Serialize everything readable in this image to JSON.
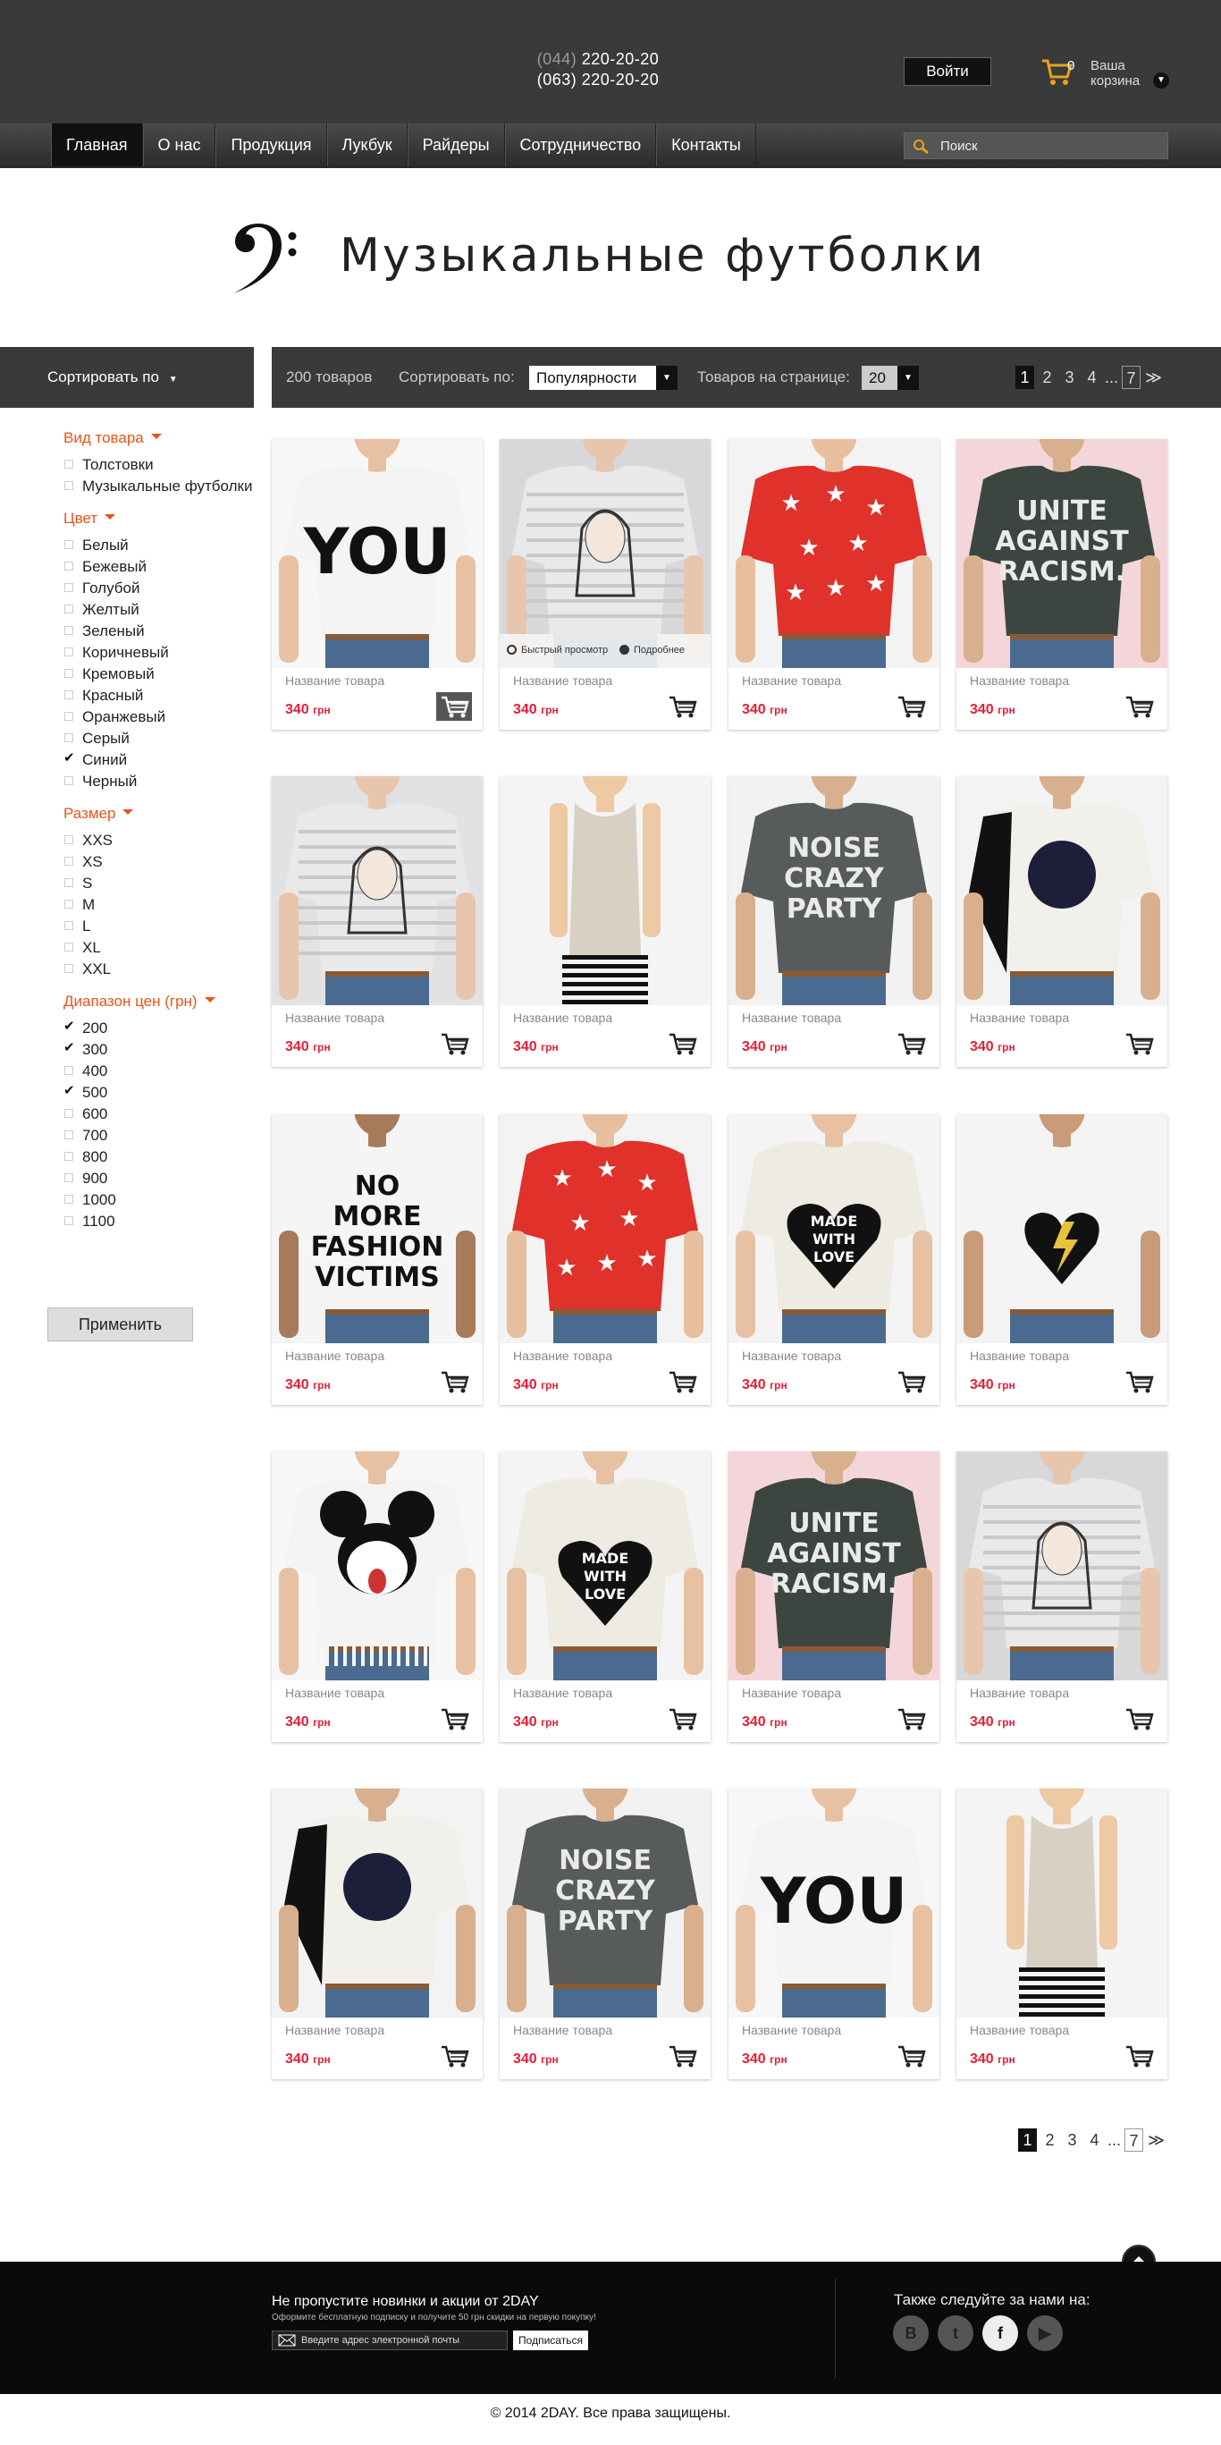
{
  "header": {
    "phone1_code": "(044)",
    "phone1_number": "220-20-20",
    "phone2": "(063) 220-20-20",
    "login_label": "Войти",
    "cart_count": "0",
    "cart_line1": "Ваша",
    "cart_line2": "корзина"
  },
  "nav": [
    "Главная",
    "О нас",
    "Продукция",
    "Лукбук",
    "Райдеры",
    "Сотрудничество",
    "Контакты"
  ],
  "search": {
    "placeholder": "Поиск"
  },
  "page_title": "Музыкальные футболки",
  "sort_side_label": "Сортировать по",
  "toolbar": {
    "count": "200 товаров",
    "sort_label": "Сортировать по:",
    "sort_value": "Популярности",
    "per_page_label": "Товаров на странице:",
    "per_page_value": "20"
  },
  "pager": {
    "pages": [
      "1",
      "2",
      "3",
      "4"
    ],
    "ellipsis": "...",
    "last": "7",
    "next": "≫"
  },
  "filters": [
    {
      "title": "Вид товара",
      "options": [
        {
          "label": "Толстовки",
          "checked": false
        },
        {
          "label": "Музыкальные футболки",
          "checked": false
        }
      ]
    },
    {
      "title": "Цвет",
      "options": [
        {
          "label": "Белый",
          "checked": false
        },
        {
          "label": "Бежевый",
          "checked": false
        },
        {
          "label": "Голубой",
          "checked": false
        },
        {
          "label": "Желтый",
          "checked": false
        },
        {
          "label": "Зеленый",
          "checked": false
        },
        {
          "label": "Коричневый",
          "checked": false
        },
        {
          "label": "Кремовый",
          "checked": false
        },
        {
          "label": "Красный",
          "checked": false
        },
        {
          "label": "Оранжевый",
          "checked": false
        },
        {
          "label": "Серый",
          "checked": false
        },
        {
          "label": "Синий",
          "checked": true
        },
        {
          "label": "Черный",
          "checked": false
        }
      ]
    },
    {
      "title": "Размер",
      "options": [
        {
          "label": "XXS",
          "checked": false
        },
        {
          "label": "XS",
          "checked": false
        },
        {
          "label": "S",
          "checked": false
        },
        {
          "label": "M",
          "checked": false
        },
        {
          "label": "L",
          "checked": false
        },
        {
          "label": "XL",
          "checked": false
        },
        {
          "label": "XXL",
          "checked": false
        }
      ]
    },
    {
      "title": "Диапазон цен (грн)",
      "options": [
        {
          "label": "200",
          "checked": true
        },
        {
          "label": "300",
          "checked": true
        },
        {
          "label": "400",
          "checked": false
        },
        {
          "label": "500",
          "checked": true
        },
        {
          "label": "600",
          "checked": false
        },
        {
          "label": "700",
          "checked": false
        },
        {
          "label": "800",
          "checked": false
        },
        {
          "label": "900",
          "checked": false
        },
        {
          "label": "1000",
          "checked": false
        },
        {
          "label": "1100",
          "checked": false
        }
      ]
    }
  ],
  "apply_label": "Применить",
  "product": {
    "name": "Название товара",
    "price": "340",
    "currency": "грн"
  },
  "quick_view_label": "Быстрый просмотр",
  "details_label": "Подробнее",
  "products": [
    {
      "design": "you",
      "shirt": "#f4f4f4",
      "skin": "#e7c1a2",
      "bg": "#f7f7f7",
      "print": "YOU"
    },
    {
      "design": "girl",
      "shirt": "#e9e9ea",
      "skin": "#e8c6ad",
      "bg": "#d8d8da",
      "print": ""
    },
    {
      "design": "stars",
      "shirt": "#e0312b",
      "skin": "#e7bf9f",
      "bg": "#f3f3f3",
      "print": ""
    },
    {
      "design": "text",
      "shirt": "#3d4540",
      "skin": "#d8b08e",
      "bg": "#f4d6da",
      "print": "UNITE AGAINST RACISM."
    },
    {
      "design": "girl",
      "shirt": "#e9e9ea",
      "skin": "#e8c6ad",
      "bg": "#e2e2e4",
      "print": ""
    },
    {
      "design": "tank",
      "shirt": "#d8d0c2",
      "skin": "#edc9a4",
      "bg": "#f4f4f4",
      "print": ""
    },
    {
      "design": "text",
      "shirt": "#575b5c",
      "skin": "#d8b08e",
      "bg": "#f2f2f2",
      "print": "NOISE CRAZY PARTY"
    },
    {
      "design": "sleeve",
      "shirt": "#f2f0ea",
      "skin": "#d8b08e",
      "bg": "#f3f3f3",
      "print": ""
    },
    {
      "design": "text",
      "shirt": "#f5f5f5",
      "skin": "#a77a5a",
      "bg": "#f5f5f5",
      "print": "NO MORE FASHION VICTIMS"
    },
    {
      "design": "stars",
      "shirt": "#e0312b",
      "skin": "#e7bf9f",
      "bg": "#f3f3f3",
      "print": ""
    },
    {
      "design": "heart",
      "shirt": "#eeebe2",
      "skin": "#e7c1a2",
      "bg": "#f4f4f4",
      "print": "MADE WITH LOVE"
    },
    {
      "design": "bolt",
      "shirt": "#f4f4f4",
      "skin": "#c99b78",
      "bg": "#f4f4f4",
      "print": ""
    },
    {
      "design": "mickey",
      "shirt": "#f4f4f4",
      "skin": "#e7c1a2",
      "bg": "#f7f7f7",
      "print": ""
    },
    {
      "design": "heart",
      "shirt": "#eeebe2",
      "skin": "#e7c1a2",
      "bg": "#f4f4f4",
      "print": "MADE WITH LOVE"
    },
    {
      "design": "text",
      "shirt": "#3d4540",
      "skin": "#d8b08e",
      "bg": "#f4d6da",
      "print": "UNITE AGAINST RACISM."
    },
    {
      "design": "girl",
      "shirt": "#e9e9ea",
      "skin": "#e8c6ad",
      "bg": "#d8d8da",
      "print": ""
    },
    {
      "design": "sleeve",
      "shirt": "#f2f0ea",
      "skin": "#d8b08e",
      "bg": "#f3f3f3",
      "print": ""
    },
    {
      "design": "text",
      "shirt": "#575b5c",
      "skin": "#d8b08e",
      "bg": "#f2f2f2",
      "print": "NOISE CRAZY PARTY"
    },
    {
      "design": "you",
      "shirt": "#f4f4f4",
      "skin": "#e7c1a2",
      "bg": "#f7f7f7",
      "print": "YOU"
    },
    {
      "design": "tank",
      "shirt": "#d8d0c2",
      "skin": "#edc9a4",
      "bg": "#f4f4f4",
      "print": ""
    }
  ],
  "footer": {
    "news_title": "Не пропустите новинки и акции от 2DAY",
    "news_sub": "Оформите бесплатную подписку и получите 50 грн скидки на первую покупку!",
    "email_placeholder": "Введите адрес электронной почты",
    "subscribe_label": "Подписаться",
    "follow_label": "Также следуйте за нами на:",
    "social": [
      "vk-icon",
      "twitter-icon",
      "facebook-icon",
      "youtube-icon"
    ],
    "copyright": "© 2014 2DAY. Все права защищены."
  },
  "colors": {
    "accent": "#e8541c",
    "price": "#e51e36",
    "dark": "#3a3a3a"
  }
}
